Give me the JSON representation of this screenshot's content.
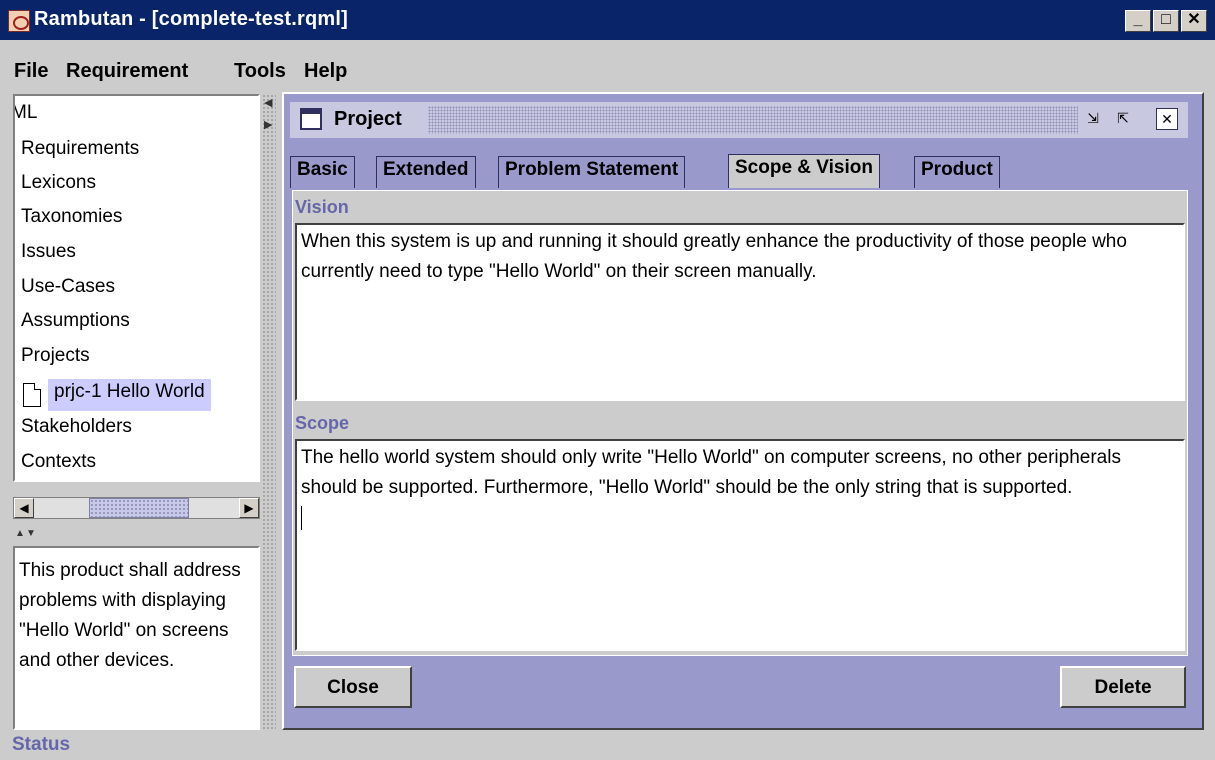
{
  "window": {
    "title": "Rambutan - [complete-test.rqml]",
    "controls": {
      "minimize": "_",
      "maximize": "□",
      "close": "✕"
    }
  },
  "menu": [
    "File",
    "Requirement",
    "Tools",
    "Help"
  ],
  "tree": {
    "items": [
      "ML",
      "Requirements",
      "Lexicons",
      "Taxonomies",
      "Issues",
      "Use-Cases",
      "Assumptions",
      "Projects"
    ],
    "selected": "prjc-1 Hello World",
    "items_after": [
      "Stakeholders",
      "Contexts"
    ]
  },
  "description": "This product shall address problems with displaying \"Hello World\" on screens and other devices.",
  "project_window": {
    "title": "Project",
    "tabs": [
      "Basic",
      "Extended",
      "Problem Statement",
      "Scope & Vision",
      "Product"
    ],
    "active_tab": "Scope & Vision",
    "vision_label": "Vision",
    "vision_text": "When this system is up and running it should greatly enhance the productivity of those people who currently need to type \"Hello World\" on their screen manually.",
    "scope_label": "Scope",
    "scope_text": "The hello world system should only write \"Hello World\" on computer screens, no other peripherals should be supported. Furthermore, \"Hello World\" should be the only string that is supported.",
    "close_button": "Close",
    "delete_button": "Delete"
  },
  "status": "Status",
  "colors": {
    "titlebar": "#0a246a",
    "accent": "#9999cc",
    "label": "#6666aa",
    "selection": "#ccccff"
  }
}
